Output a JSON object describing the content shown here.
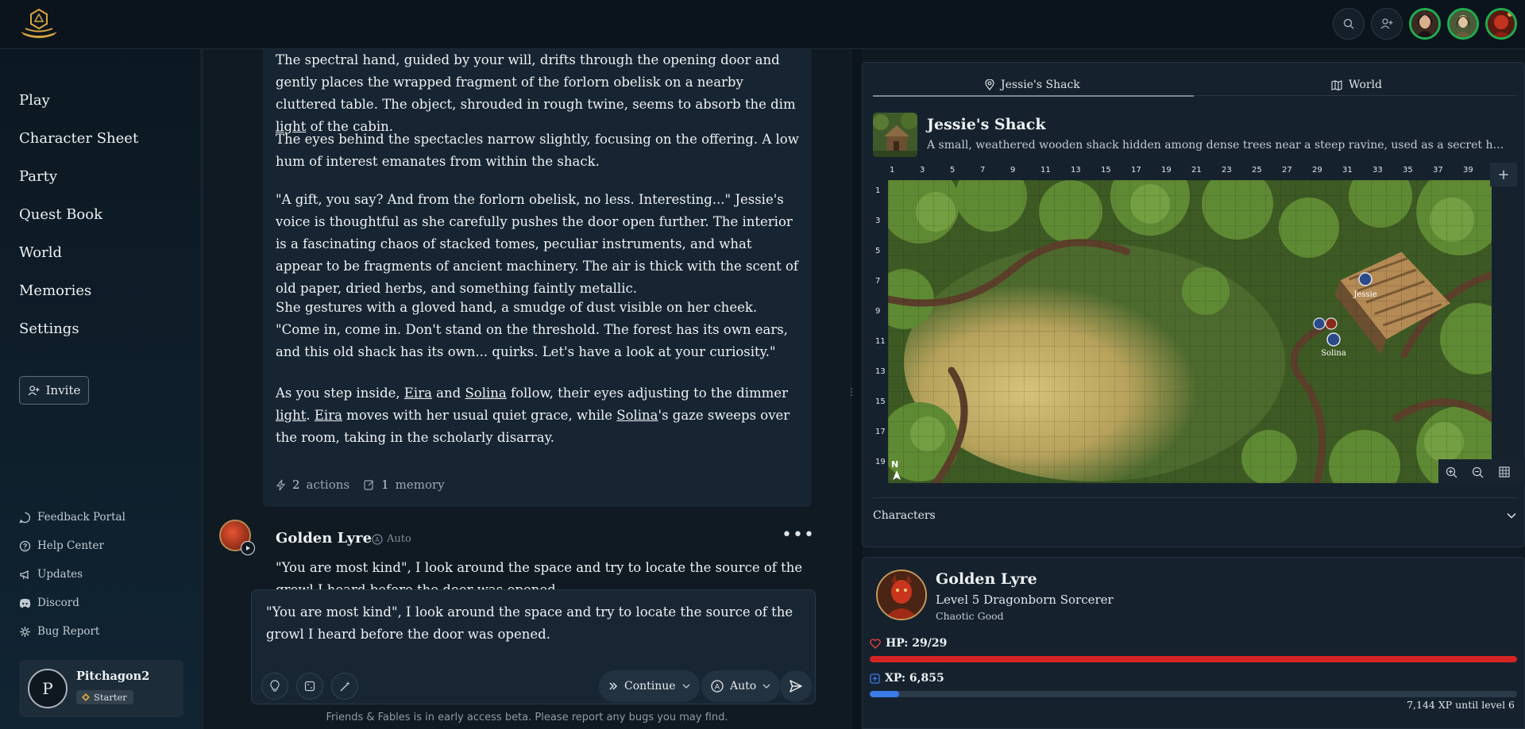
{
  "header": {
    "icons": [
      "search-icon",
      "add-user-icon"
    ]
  },
  "sidebar": {
    "nav": [
      "Play",
      "Character Sheet",
      "Party",
      "Quest Book",
      "World",
      "Memories",
      "Settings"
    ],
    "invite_label": "Invite",
    "footer_links": [
      {
        "label": "Feedback Portal",
        "icon": "chat-bubble-icon"
      },
      {
        "label": "Help Center",
        "icon": "help-circle-icon"
      },
      {
        "label": "Updates",
        "icon": "megaphone-icon"
      },
      {
        "label": "Discord",
        "icon": "discord-icon"
      },
      {
        "label": "Bug Report",
        "icon": "bug-icon"
      }
    ],
    "user": {
      "initial": "P",
      "name": "Pitchagon2",
      "badge": "Starter"
    }
  },
  "chat": {
    "message": {
      "p1": {
        "a": "The spectral hand, guided by your will, drifts through the opening door and gently places the wrapped fragment of the forlorn obelisk on a nearby cluttered table. The object, shrouded in rough twine, seems to absorb the dim ",
        "link": "light",
        "b": " of the cabin."
      },
      "p2": "The eyes behind the spectacles narrow slightly, focusing on the offering. A low hum of interest emanates from within the shack.",
      "p3": "\"A gift, you say? And from the forlorn obelisk, no less. Interesting...\" Jessie's voice is thoughtful as she carefully pushes the door open further. The interior is a fascinating chaos of stacked tomes, peculiar instruments, and what appear to be fragments of ancient machinery. The air is thick with the scent of old paper, dried herbs, and something faintly metallic.",
      "p4": "She gestures with a gloved hand, a smudge of dust visible on her cheek. \"Come in, come in. Don't stand on the threshold. The forest has its own ears, and this old shack has its own... quirks. Let's have a look at your curiosity.\"",
      "p5": {
        "a": "As you step inside, ",
        "eira": "Eira",
        "and": " and ",
        "solina": "Solina",
        "b": " follow, their eyes adjusting to the dimmer ",
        "light": "light",
        "c": ". ",
        "eira2": "Eira",
        "d": " moves with her usual quiet grace, while ",
        "solina2": "Solina",
        "e": "'s gaze sweeps over the room, taking in the scholarly disarray."
      },
      "actions_count": "2",
      "actions_label": "actions",
      "memory_count": "1",
      "memory_label": "memory"
    },
    "reply": {
      "name": "Golden Lyre",
      "mode": "Auto",
      "text": "\"You are most kind\", I look around the space and try to locate the source of the growl I heard before the door was opened."
    },
    "composer": {
      "text": "\"You are most kind\", I look around the space and try to locate the source of the growl I heard before the door was opened.",
      "continue_label": "Continue",
      "auto_label": "Auto"
    },
    "beta_note": "Friends & Fables is in early access beta. Please report any bugs you may find."
  },
  "map_panel": {
    "tabs": [
      "Jessie's Shack",
      "World"
    ],
    "location": {
      "title": "Jessie's Shack",
      "description": "A small, weathered wooden shack hidden among dense trees near a steep ravine, used as a secret hideout or..."
    },
    "col_labels": [
      "1",
      "3",
      "5",
      "7",
      "9",
      "11",
      "13",
      "15",
      "17",
      "19",
      "21",
      "23",
      "25",
      "27",
      "29",
      "31",
      "33",
      "35",
      "37",
      "39"
    ],
    "row_labels": [
      "1",
      "3",
      "5",
      "7",
      "9",
      "11",
      "13",
      "15",
      "17",
      "19"
    ],
    "compass": "N",
    "tokens": [
      "Jessie",
      "Solina"
    ],
    "add_label": "+",
    "characters_label": "Characters"
  },
  "character": {
    "name": "Golden Lyre",
    "class_line": "Level 5 Dragonborn Sorcerer",
    "alignment": "Chaotic Good",
    "hp_label": "HP: 29/29",
    "hp_fraction": 1.0,
    "xp_label": "XP: 6,855",
    "xp_fraction": 0.045,
    "xp_note": "7,144 XP until level 6",
    "colors": {
      "hp": "#d62424",
      "xp": "#3b7be8"
    }
  }
}
